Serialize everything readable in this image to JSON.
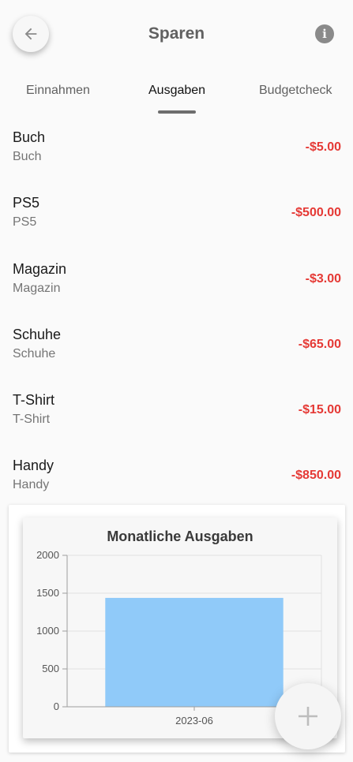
{
  "header": {
    "title": "Sparen",
    "back_icon": "arrow-left-icon",
    "info_icon": "info-icon"
  },
  "tabs": [
    {
      "label": "Einnahmen",
      "active": false
    },
    {
      "label": "Ausgaben",
      "active": true
    },
    {
      "label": "Budgetcheck",
      "active": false
    }
  ],
  "expenses": [
    {
      "title": "Buch",
      "subtitle": "Buch",
      "amount": "-$5.00"
    },
    {
      "title": "PS5",
      "subtitle": "PS5",
      "amount": "-$500.00"
    },
    {
      "title": "Magazin",
      "subtitle": "Magazin",
      "amount": "-$3.00"
    },
    {
      "title": "Schuhe",
      "subtitle": "Schuhe",
      "amount": "-$65.00"
    },
    {
      "title": "T-Shirt",
      "subtitle": "T-Shirt",
      "amount": "-$15.00"
    },
    {
      "title": "Handy",
      "subtitle": "Handy",
      "amount": "-$850.00"
    }
  ],
  "colors": {
    "amount": "#e53935",
    "bar": "#90caf9"
  },
  "fab": {
    "icon": "plus-icon"
  },
  "chart_data": {
    "type": "bar",
    "title": "Monatliche Ausgaben",
    "categories": [
      "2023-06"
    ],
    "values": [
      1438
    ],
    "ylim": [
      0,
      2000
    ],
    "yticks": [
      0,
      500,
      1000,
      1500,
      2000
    ],
    "grid": true
  }
}
